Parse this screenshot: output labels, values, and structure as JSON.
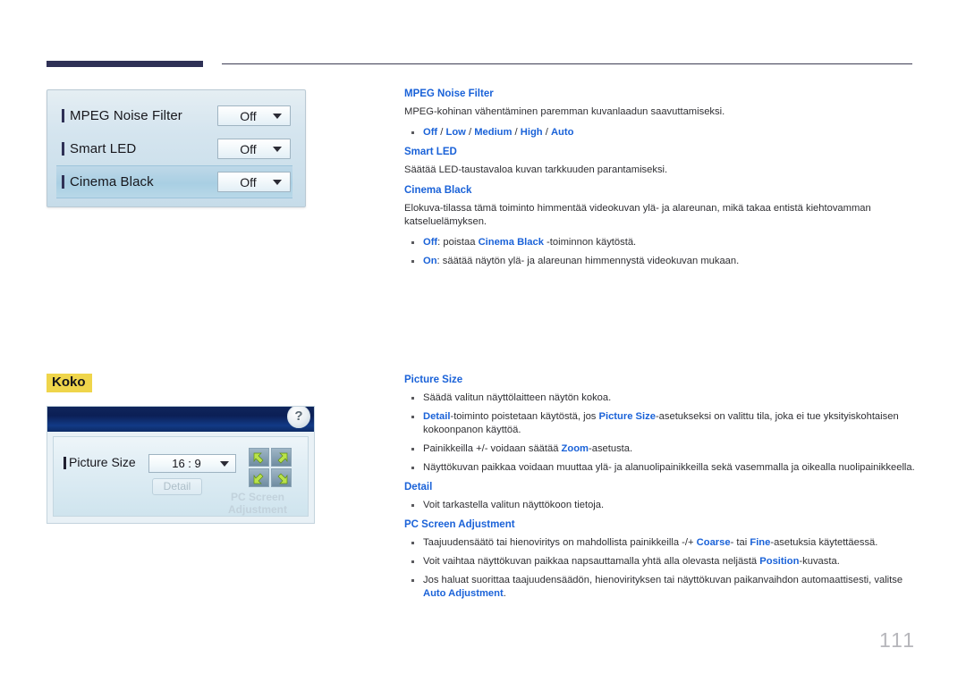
{
  "page": {
    "number": "111"
  },
  "osd_panel_1": {
    "name": "picture-options-osd",
    "rows": [
      {
        "label": "MPEG Noise Filter",
        "value": "Off",
        "selected": false
      },
      {
        "label": "Smart LED",
        "value": "Off",
        "selected": false
      },
      {
        "label": "Cinema Black",
        "value": "Off",
        "selected": true
      }
    ]
  },
  "section_koko": {
    "heading": "Koko"
  },
  "osd_panel_2": {
    "name": "picture-size-osd",
    "help_glyph": "?",
    "picture_size_label": "Picture Size",
    "picture_size_value": "16 : 9",
    "detail_button": "Detail",
    "pc_screen_adjustment": "PC Screen Adjustment"
  },
  "doc": {
    "mpeg_noise_filter": {
      "heading": "MPEG Noise Filter",
      "description": "MPEG-kohinan vähentäminen paremman kuvanlaadun saavuttamiseksi.",
      "options": {
        "o1": "Off",
        "s1": " / ",
        "o2": "Low",
        "s2": " / ",
        "o3": "Medium",
        "s3": " / ",
        "o4": "High",
        "s4": " / ",
        "o5": "Auto"
      }
    },
    "smart_led": {
      "heading": "Smart LED",
      "description": "Säätää LED-taustavaloa kuvan tarkkuuden parantamiseksi."
    },
    "cinema_black": {
      "heading": "Cinema Black",
      "description": "Elokuva-tilassa tämä toiminto himmentää videokuvan ylä- ja alareunan, mikä takaa entistä kiehtovamman katseluelämyksen.",
      "bullet_off_term": "Off",
      "bullet_off_mid": ": poistaa ",
      "bullet_off_term2": "Cinema Black",
      "bullet_off_end": " -toiminnon käytöstä.",
      "bullet_on_term": "On",
      "bullet_on_text": ": säätää näytön ylä- ja alareunan himmennystä videokuvan mukaan."
    },
    "picture_size": {
      "heading": "Picture Size",
      "b1": "Säädä valitun näyttölaitteen näytön kokoa.",
      "b2_t1": "Detail",
      "b2_m1": "-toiminto poistetaan käytöstä, jos ",
      "b2_t2": "Picture Size",
      "b2_m2": "-asetukseksi on valittu tila, joka ei tue yksityiskohtaisen kokoonpanon käyttöä.",
      "b3_pre": "Painikkeilla +/- voidaan säätää ",
      "b3_t": "Zoom",
      "b3_post": "-asetusta.",
      "b4": "Näyttökuvan paikkaa voidaan muuttaa ylä- ja alanuolipainikkeilla sekä vasemmalla ja oikealla nuolipainikkeella."
    },
    "detail": {
      "heading": "Detail",
      "b1": "Voit tarkastella valitun näyttökoon tietoja."
    },
    "pc_screen_adjustment": {
      "heading": "PC Screen Adjustment",
      "b1_pre": "Taajuudensäätö tai hienoviritys on mahdollista painikkeilla -/+ ",
      "b1_t1": "Coarse",
      "b1_mid": "- tai ",
      "b1_t2": "Fine",
      "b1_post": "-asetuksia käytettäessä.",
      "b2_pre": "Voit vaihtaa näyttökuvan paikkaa napsauttamalla yhtä alla olevasta neljästä ",
      "b2_t": "Position",
      "b2_post": "-kuvasta.",
      "b3_pre": "Jos haluat suorittaa taajuudensäädön, hienovirityksen tai näyttökuvan paikanvaihdon automaattisesti, valitse ",
      "b3_t": "Auto Adjustment",
      "b3_post": "."
    }
  },
  "colors": {
    "accent_blue": "#1a62d8",
    "rule_navy": "#2f3156",
    "highlight_yellow": "#efd54b"
  }
}
